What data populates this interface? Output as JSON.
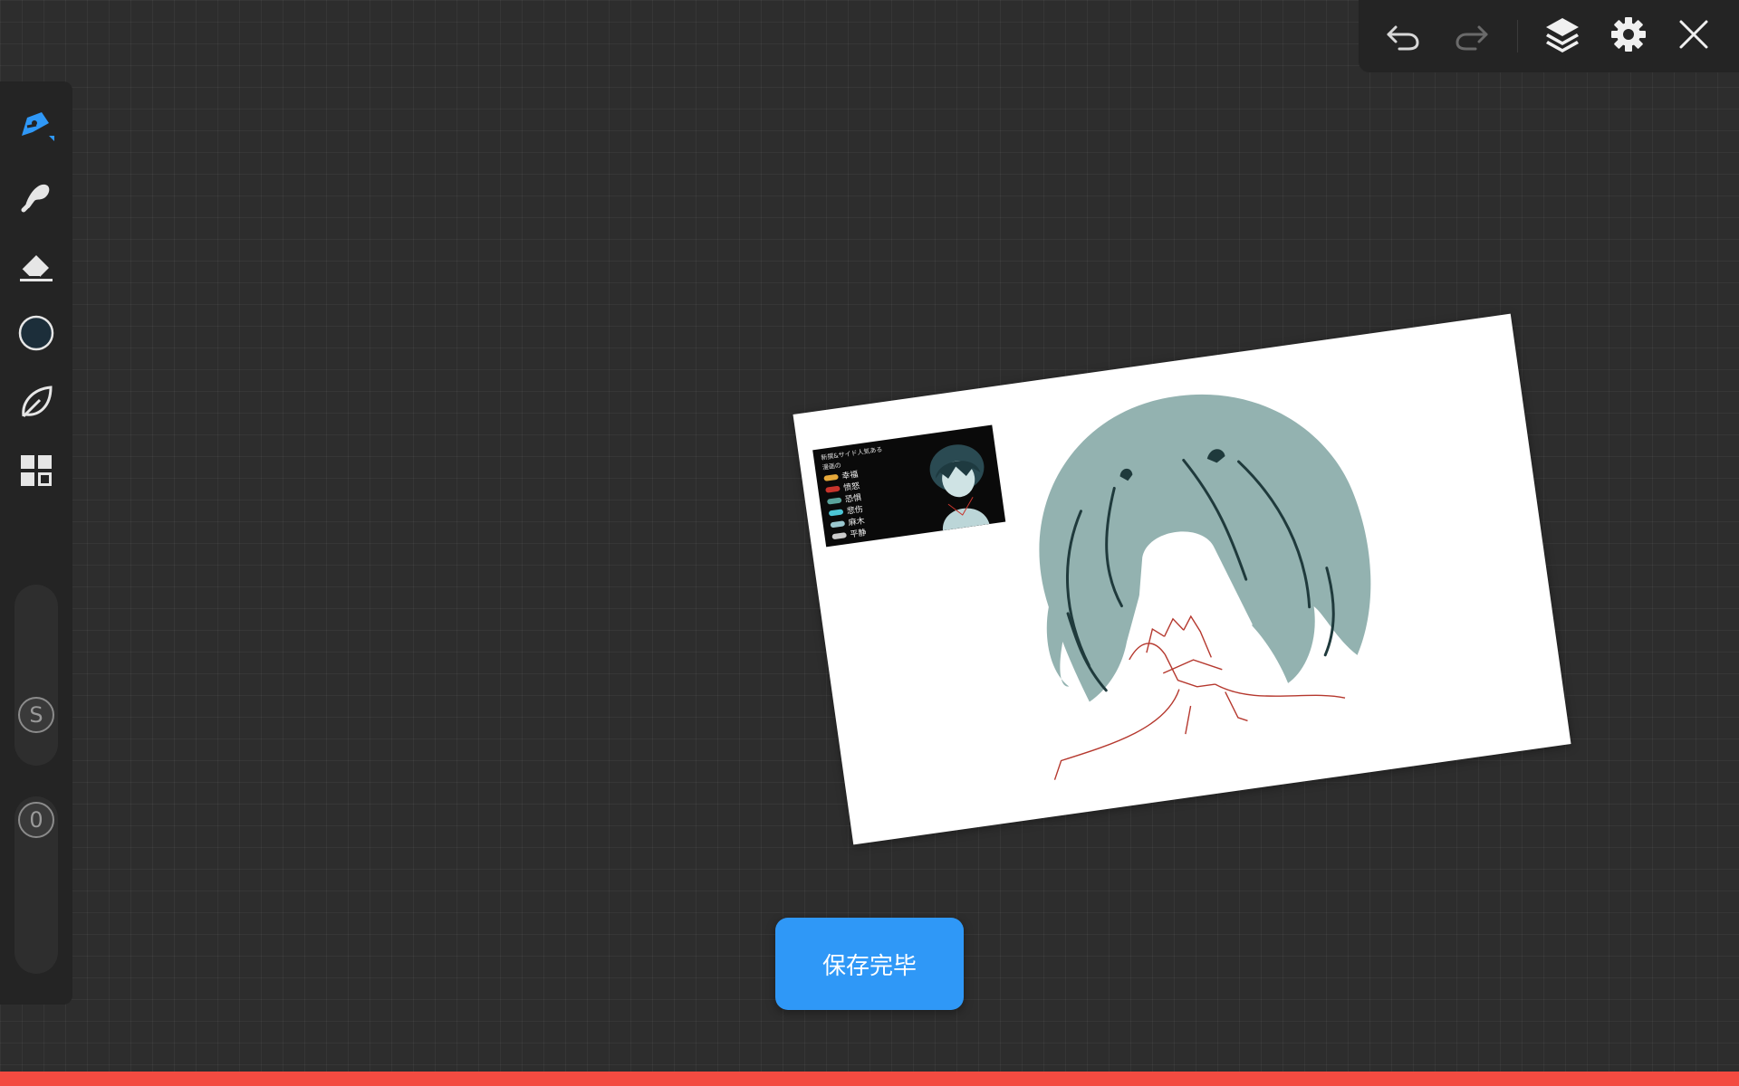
{
  "colors": {
    "background": "#2d2d2d",
    "toolbar": "#242424",
    "accent_blue": "#2f98f7",
    "current_color": "#1c2e3a",
    "bottom_bar": "#f34b41",
    "hair": "#93b2b0"
  },
  "left_toolbar": {
    "tools": [
      {
        "name": "pen",
        "icon": "pen-nib-icon",
        "active": true
      },
      {
        "name": "brush",
        "icon": "brush-icon",
        "active": false
      },
      {
        "name": "eraser",
        "icon": "eraser-icon",
        "active": false
      },
      {
        "name": "color",
        "icon": "color-circle-icon",
        "active": false
      },
      {
        "name": "leaf",
        "icon": "leaf-icon",
        "active": false
      },
      {
        "name": "grid",
        "icon": "grid-icon",
        "active": false
      }
    ],
    "size_slider_label": "S",
    "opacity_slider_label": "0"
  },
  "top_toolbar": {
    "buttons": [
      "undo-icon",
      "redo-icon",
      "layers-icon",
      "settings-icon",
      "close-icon"
    ]
  },
  "reference_image": {
    "title": "新撰&サイド人気ある",
    "subtitle": "漫画の",
    "list": [
      {
        "label": "幸福",
        "color": "#e7a93a"
      },
      {
        "label": "愤怒",
        "color": "#c8342c"
      },
      {
        "label": "恐惧",
        "color": "#5aa39b"
      },
      {
        "label": "悲伤",
        "color": "#4cc6d6"
      },
      {
        "label": "麻木",
        "color": "#9ac7cf"
      },
      {
        "label": "平静",
        "color": "#cccccc"
      }
    ]
  },
  "toast": {
    "label": "保存完毕"
  }
}
